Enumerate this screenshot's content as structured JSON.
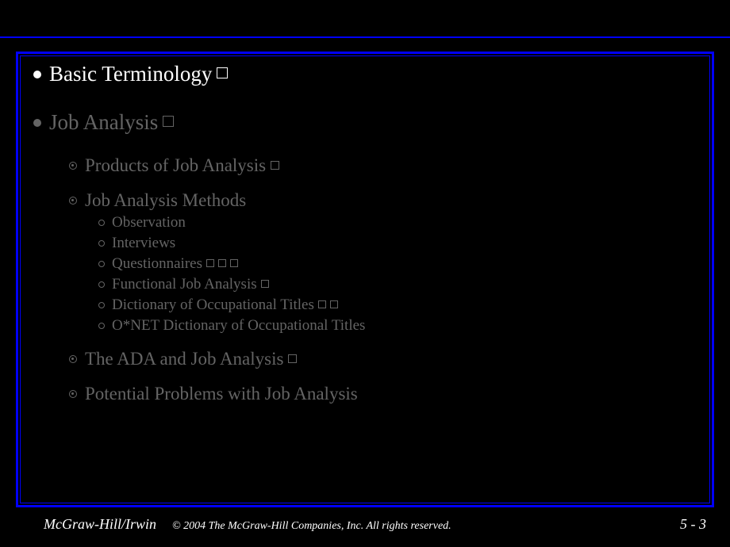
{
  "items": {
    "basic": "Basic Terminology",
    "job": "Job Analysis",
    "products": "Products of Job Analysis",
    "methods": "Job Analysis Methods",
    "obs": "Observation",
    "int": "Interviews",
    "ques": "Questionnaires",
    "fja": "Functional Job Analysis",
    "dot": "Dictionary of Occupational Titles",
    "onet": "O*NET Dictionary of Occupational Titles",
    "ada": "The ADA and Job Analysis",
    "prob": "Potential Problems with Job Analysis"
  },
  "footer": {
    "left": "McGraw-Hill/Irwin",
    "center": "© 2004 The McGraw-Hill Companies, Inc. All rights reserved.",
    "right": "5 - 3"
  }
}
